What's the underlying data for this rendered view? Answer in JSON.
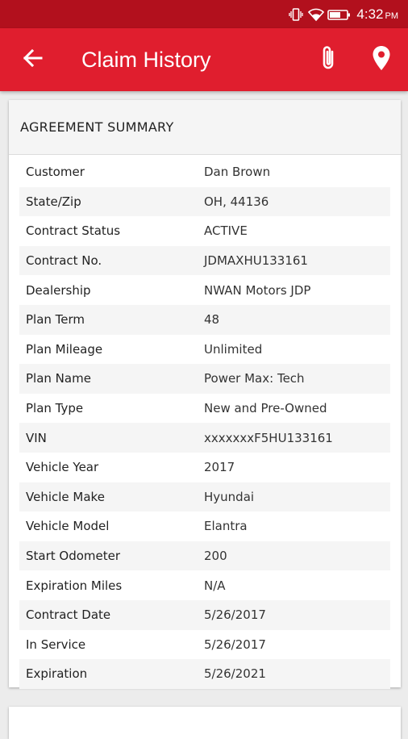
{
  "status_bar": {
    "time": "4:32",
    "ampm": "PM",
    "icons": [
      "vibrate-icon",
      "wifi-icon",
      "battery-icon"
    ]
  },
  "app_bar": {
    "title": "Claim History",
    "icons": [
      "back-arrow-icon",
      "paperclip-icon",
      "location-pin-icon"
    ],
    "color": "#e01e2e"
  },
  "agreement_summary": {
    "header": "AGREEMENT SUMMARY",
    "rows": [
      {
        "label": "Customer",
        "value": "Dan Brown"
      },
      {
        "label": "State/Zip",
        "value": "OH, 44136"
      },
      {
        "label": "Contract Status",
        "value": "ACTIVE"
      },
      {
        "label": "Contract No.",
        "value": "JDMAXHU133161"
      },
      {
        "label": "Dealership",
        "value": "NWAN Motors JDP"
      },
      {
        "label": "Plan Term",
        "value": "48"
      },
      {
        "label": "Plan Mileage",
        "value": "Unlimited"
      },
      {
        "label": "Plan Name",
        "value": "Power Max:  Tech"
      },
      {
        "label": "Plan Type",
        "value": "New and Pre-Owned"
      },
      {
        "label": "VIN",
        "value": "xxxxxxxF5HU133161"
      },
      {
        "label": "Vehicle Year",
        "value": "2017"
      },
      {
        "label": "Vehicle Make",
        "value": "Hyundai"
      },
      {
        "label": "Vehicle Model",
        "value": "Elantra"
      },
      {
        "label": "Start Odometer",
        "value": "200"
      },
      {
        "label": "Expiration Miles",
        "value": "N/A"
      },
      {
        "label": "Contract Date",
        "value": "5/26/2017"
      },
      {
        "label": "In Service",
        "value": "5/26/2017"
      },
      {
        "label": "Expiration",
        "value": "5/26/2021"
      }
    ]
  }
}
